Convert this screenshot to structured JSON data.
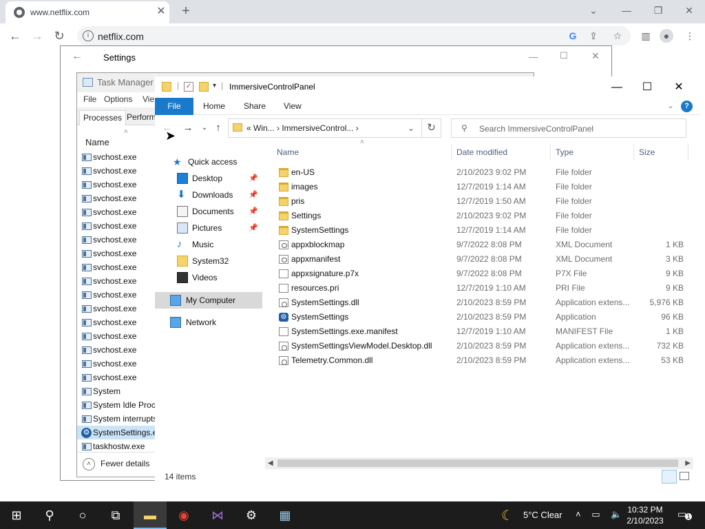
{
  "browser": {
    "tab_title": "www.netflix.com",
    "url": "netflix.com"
  },
  "settings": {
    "title": "Settings"
  },
  "task_manager": {
    "title": "Task Manager",
    "menus": [
      "File",
      "Options",
      "Vie"
    ],
    "tabs": [
      "Processes",
      "Perform"
    ],
    "name_column": "Name",
    "processes": [
      "svchost.exe",
      "svchost.exe",
      "svchost.exe",
      "svchost.exe",
      "svchost.exe",
      "svchost.exe",
      "svchost.exe",
      "svchost.exe",
      "svchost.exe",
      "svchost.exe",
      "svchost.exe",
      "svchost.exe",
      "svchost.exe",
      "svchost.exe",
      "svchost.exe",
      "svchost.exe",
      "svchost.exe",
      "System",
      "System Idle Proce",
      "System interrupts",
      "SystemSettings.ex",
      "taskhostw.exe"
    ],
    "selected_process": "SystemSettings.ex",
    "fewer_details": "Fewer details"
  },
  "explorer": {
    "title": "ImmersiveControlPanel",
    "ribbon_tabs": {
      "file": "File",
      "home": "Home",
      "share": "Share",
      "view": "View"
    },
    "address": "«  Win...  ›  ImmersiveControl...  ›",
    "search_placeholder": "Search ImmersiveControlPanel",
    "nav": {
      "quick_access": "Quick access",
      "desktop": "Desktop",
      "downloads": "Downloads",
      "documents": "Documents",
      "pictures": "Pictures",
      "music": "Music",
      "system32": "System32",
      "videos": "Videos",
      "my_computer": "My Computer",
      "network": "Network"
    },
    "columns": {
      "name": "Name",
      "date": "Date modified",
      "type": "Type",
      "size": "Size"
    },
    "files": [
      {
        "name": "en-US",
        "date": "2/10/2023 9:02 PM",
        "type": "File folder",
        "size": ""
      },
      {
        "name": "images",
        "date": "12/7/2019 1:14 AM",
        "type": "File folder",
        "size": ""
      },
      {
        "name": "pris",
        "date": "12/7/2019 1:50 AM",
        "type": "File folder",
        "size": ""
      },
      {
        "name": "Settings",
        "date": "2/10/2023 9:02 PM",
        "type": "File folder",
        "size": ""
      },
      {
        "name": "SystemSettings",
        "date": "12/7/2019 1:14 AM",
        "type": "File folder",
        "size": ""
      },
      {
        "name": "appxblockmap",
        "date": "9/7/2022 8:08 PM",
        "type": "XML Document",
        "size": "1 KB"
      },
      {
        "name": "appxmanifest",
        "date": "9/7/2022 8:08 PM",
        "type": "XML Document",
        "size": "3 KB"
      },
      {
        "name": "appxsignature.p7x",
        "date": "9/7/2022 8:08 PM",
        "type": "P7X File",
        "size": "9 KB"
      },
      {
        "name": "resources.pri",
        "date": "12/7/2019 1:10 AM",
        "type": "PRI File",
        "size": "9 KB"
      },
      {
        "name": "SystemSettings.dll",
        "date": "2/10/2023 8:59 PM",
        "type": "Application extens...",
        "size": "5,976 KB"
      },
      {
        "name": "SystemSettings",
        "date": "2/10/2023 8:59 PM",
        "type": "Application",
        "size": "96 KB"
      },
      {
        "name": "SystemSettings.exe.manifest",
        "date": "12/7/2019 1:10 AM",
        "type": "MANIFEST File",
        "size": "1 KB"
      },
      {
        "name": "SystemSettingsViewModel.Desktop.dll",
        "date": "2/10/2023 8:59 PM",
        "type": "Application extens...",
        "size": "732 KB"
      },
      {
        "name": "Telemetry.Common.dll",
        "date": "2/10/2023 8:59 PM",
        "type": "Application extens...",
        "size": "53 KB"
      }
    ],
    "status": "14 items"
  },
  "taskbar": {
    "weather": "5°C  Clear",
    "time": "10:32 PM",
    "date": "2/10/2023",
    "notifications": "1"
  },
  "colors": {
    "accent": "#1979ca",
    "taskbar": "#1c1c1c",
    "selection": "#cce4f7"
  }
}
